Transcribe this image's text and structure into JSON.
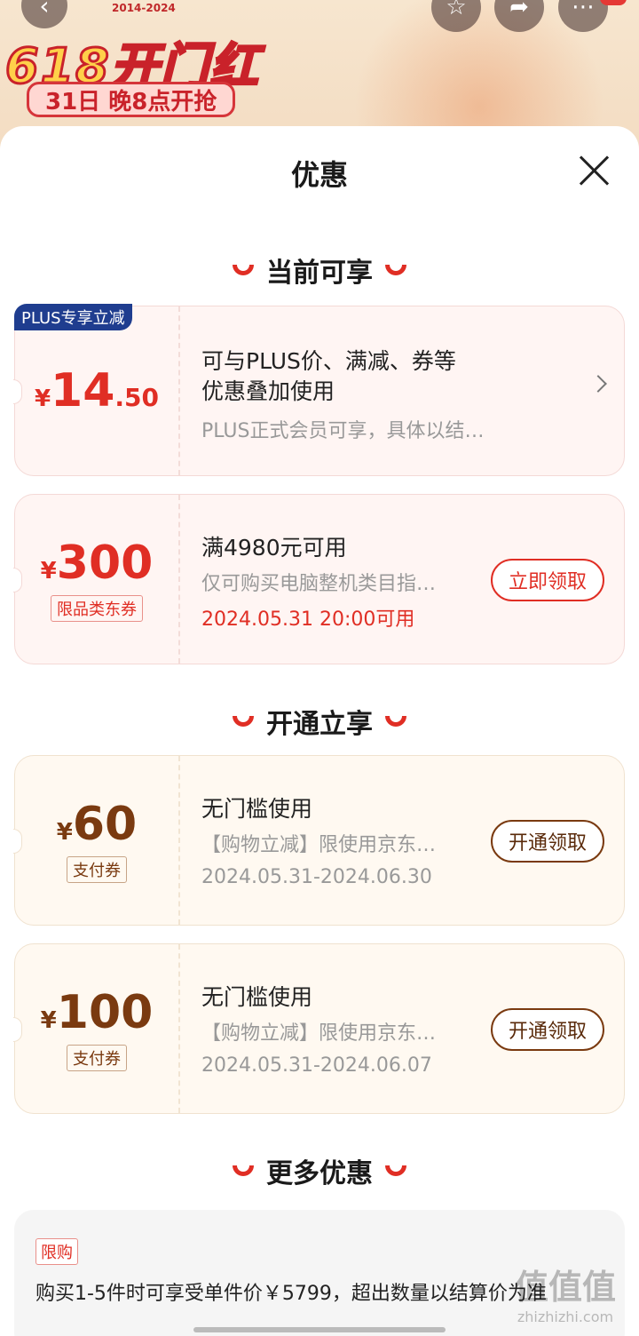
{
  "banner": {
    "years": "2014-2024",
    "title": "618开门红",
    "subtitle": "31日 晚8点开抢"
  },
  "sheet": {
    "title": "优惠"
  },
  "sections": {
    "current": "当前可享",
    "open": "开通立享",
    "more": "更多优惠"
  },
  "coupons": [
    {
      "badge": "PLUS专享立减",
      "yen": "¥",
      "amount": "14",
      "decimal": ".50",
      "line1": "可与PLUS价、满减、券等",
      "line1b": "优惠叠加使用",
      "line2": "PLUS正式会员可享，具体以结…"
    },
    {
      "yen": "¥",
      "amount": "300",
      "tag": "限品类东券",
      "line1": "满4980元可用",
      "line2": "仅可购买电脑整机类目指…",
      "line3": "2024.05.31 20:00可用",
      "button": "立即领取"
    },
    {
      "yen": "¥",
      "amount": "60",
      "tag": "支付券",
      "line1": "无门槛使用",
      "line2": "【购物立减】限使用京东…",
      "line3": "2024.05.31-2024.06.30",
      "button": "开通领取"
    },
    {
      "yen": "¥",
      "amount": "100",
      "tag": "支付券",
      "line1": "无门槛使用",
      "line2": "【购物立减】限使用京东…",
      "line3": "2024.05.31-2024.06.07",
      "button": "开通领取"
    }
  ],
  "more": {
    "tag": "限购",
    "text": "购买1-5件时可享受单件价￥5799，超出数量以结算价为准"
  },
  "watermark": {
    "big": "值值值",
    "small": "zhizhizhi.com"
  },
  "colors": {
    "accent": "#e02e24",
    "gold": "#7a3a10",
    "plus_badge": "#1f3d8f"
  }
}
